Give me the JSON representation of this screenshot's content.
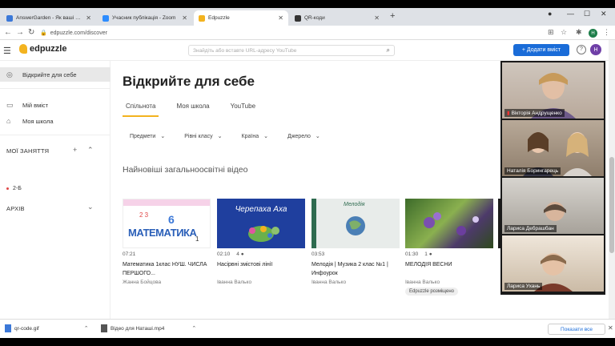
{
  "browser": {
    "tabs": [
      {
        "title": "AnswerGarden - Як ваші враж",
        "fav_color": "#3b78d8"
      },
      {
        "title": "Учасник публікація - Zoom",
        "fav_color": "#2d8cff"
      },
      {
        "title": "Edpuzzle",
        "fav_color": "#f3b31f"
      },
      {
        "title": "QR-коди",
        "fav_color": "#333333"
      }
    ],
    "url": "edpuzzle.com/discover",
    "profile_initial": "H"
  },
  "app": {
    "logo": "edpuzzle",
    "search_placeholder": "Знайдіть або вставте URL-адресу YouTube",
    "add_button": "+ Додати вміст",
    "help": "?",
    "user_initial": "H",
    "accent": "#f3b31f",
    "brand_blue": "#1a6cd8"
  },
  "sidebar": {
    "discover": "Відкрийте для себе",
    "my_content": "Мій вміст",
    "my_school": "Моя школа",
    "my_classes": "МОЇ ЗАНЯТТЯ",
    "class_item": "2-Б",
    "archive": "АРХІВ"
  },
  "main": {
    "heading": "Відкрийте для себе",
    "tabs": [
      "Спільнота",
      "Моя школа",
      "YouTube"
    ],
    "filters": [
      "Предмети",
      "Рівні класу",
      "Країна",
      "Джерело"
    ],
    "section_title": "Найновіші загальноосвітні відео",
    "cards": [
      {
        "duration": "07:21",
        "questions": "",
        "title": "Математика 1клас НУШ. ЧИСЛА ПЕРШОГО...",
        "author": "Жанна Бойцова",
        "badge": "",
        "thumb_text": "МАТЕМАТИКА"
      },
      {
        "duration": "02:10",
        "questions": "4",
        "title": "Насipвні змістові лінії",
        "author": "Іванна Валько",
        "badge": "",
        "thumb_text": "Черепаха Аха"
      },
      {
        "duration": "03:53",
        "questions": "",
        "title": "Мелодія | Музика 2 клас №1 | Инфоурок",
        "author": "Іванна Валько",
        "badge": "",
        "thumb_text": "Мелодія"
      },
      {
        "duration": "01:30",
        "questions": "1",
        "title": "МЕЛОДІЯ ВЕСНИ",
        "author": "Іванна Валько",
        "badge": "Edpuzzle розміщено",
        "thumb_text": ""
      }
    ]
  },
  "zoom": {
    "participants": [
      "Вікторія Андрущенко",
      "Наталія Борингарець",
      "Лариса Дебрашбан",
      "Лариса Ухань"
    ]
  },
  "downloads": {
    "items": [
      "qr-code.gif",
      "Відео для Наташі.mp4"
    ],
    "show_all": "Показати все"
  }
}
